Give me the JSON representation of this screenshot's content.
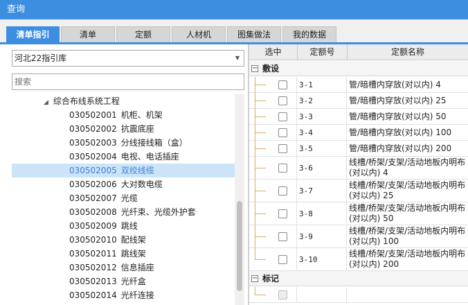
{
  "window": {
    "title": "查询"
  },
  "tabs": [
    {
      "label": "清单指引",
      "active": true
    },
    {
      "label": "清单",
      "active": false
    },
    {
      "label": "定额",
      "active": false
    },
    {
      "label": "人材机",
      "active": false
    },
    {
      "label": "图集做法",
      "active": false
    },
    {
      "label": "我的数据",
      "active": false
    }
  ],
  "library": {
    "selected": "河北22指引库"
  },
  "search": {
    "placeholder": "搜索"
  },
  "tree": {
    "root_label": "综合布线系统工程",
    "items": [
      {
        "code": "030502001",
        "name": "机柜、机架"
      },
      {
        "code": "030502002",
        "name": "抗震底座"
      },
      {
        "code": "030502003",
        "name": "分线接线箱（盒）"
      },
      {
        "code": "030502004",
        "name": "电视、电话插座"
      },
      {
        "code": "030502005",
        "name": "双绞线缆",
        "selected": true
      },
      {
        "code": "030502006",
        "name": "大对数电缆"
      },
      {
        "code": "030502007",
        "name": "光缆"
      },
      {
        "code": "030502008",
        "name": "光纤束、光缆外护套"
      },
      {
        "code": "030502009",
        "name": "跳线"
      },
      {
        "code": "030502010",
        "name": "配线架"
      },
      {
        "code": "030502011",
        "name": "跳线架"
      },
      {
        "code": "030502012",
        "name": "信息插座"
      },
      {
        "code": "030502013",
        "name": "光纤盒"
      },
      {
        "code": "030502014",
        "name": "光纤连接"
      }
    ]
  },
  "grid": {
    "columns": [
      "选中",
      "定额号",
      "定额名称"
    ],
    "groups": [
      {
        "label": "敷设",
        "rows": [
          {
            "code": "3-1",
            "name": "管/暗槽内穿放(对以内) 4"
          },
          {
            "code": "3-2",
            "name": "管/暗槽内穿放(对以内) 25"
          },
          {
            "code": "3-3",
            "name": "管/暗槽内穿放(对以内) 50"
          },
          {
            "code": "3-4",
            "name": "管/暗槽内穿放(对以内) 100"
          },
          {
            "code": "3-5",
            "name": "管/暗槽内穿放(对以内) 200"
          },
          {
            "code": "3-6",
            "name": "线槽/桥架/支架/活动地板内明布",
            "name2": "(对以内) 4"
          },
          {
            "code": "3-7",
            "name": "线槽/桥架/支架/活动地板内明布",
            "name2": "(对以内) 25"
          },
          {
            "code": "3-8",
            "name": "线槽/桥架/支架/活动地板内明布",
            "name2": "(对以内) 50"
          },
          {
            "code": "3-9",
            "name": "线槽/桥架/支架/活动地板内明布",
            "name2": "(对以内) 100"
          },
          {
            "code": "3-10",
            "name": "线槽/桥架/支架/活动地板内明布",
            "name2": "(对以内) 200"
          }
        ]
      },
      {
        "label": "标记",
        "rows": []
      }
    ]
  },
  "colors": {
    "accent": "#3d8de0",
    "selection": "#cce4f7"
  }
}
